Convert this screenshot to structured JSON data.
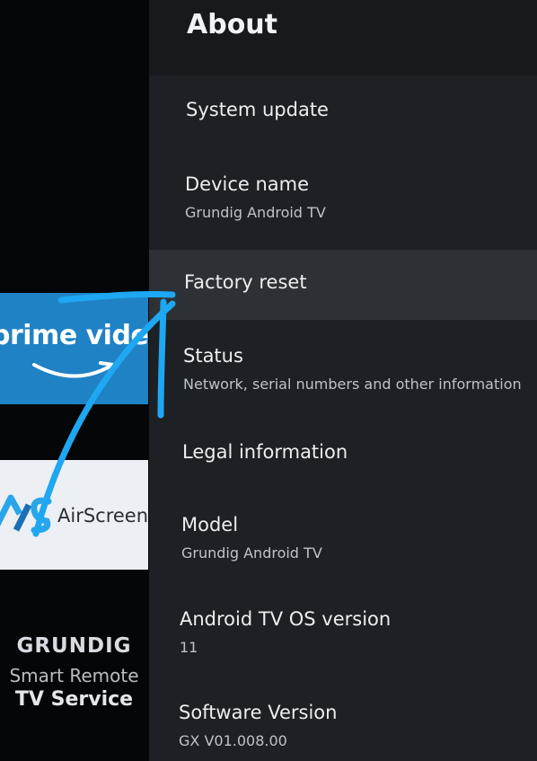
{
  "left_panel": {
    "prime_tile": {
      "label": "prime video"
    },
    "airscreen_tile": {
      "label": "AirScreen"
    },
    "brand": {
      "name": "GRUNDIG",
      "subtitle": "Smart Remote",
      "service": "TV Service"
    }
  },
  "settings": {
    "title": "About",
    "items": [
      {
        "label": "System update",
        "sublabel": ""
      },
      {
        "label": "Device name",
        "sublabel": "Grundig Android TV"
      },
      {
        "label": "Factory reset",
        "sublabel": ""
      },
      {
        "label": "Status",
        "sublabel": "Network, serial numbers and other information"
      },
      {
        "label": "Legal information",
        "sublabel": ""
      },
      {
        "label": "Model",
        "sublabel": "Grundig Android TV"
      },
      {
        "label": "Android TV OS version",
        "sublabel": "11"
      },
      {
        "label": "Software Version",
        "sublabel": "GX V01.008.00"
      }
    ],
    "selected_item": "Factory reset"
  },
  "annotation": {
    "color": "#1ea7f2",
    "icon": "arrow-annotation"
  },
  "colors": {
    "panel_bg": "#1d2024",
    "selected_bg": "#2d3136",
    "prime_blue": "#1f82c4"
  }
}
